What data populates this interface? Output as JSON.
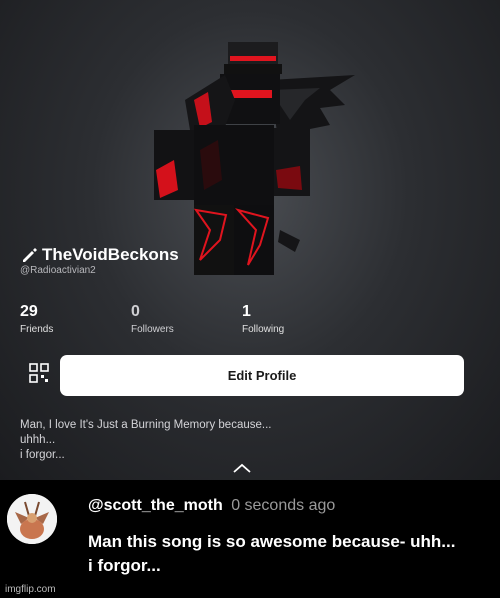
{
  "profile": {
    "display_name": "TheVoidBeckons",
    "username": "@Radioactivian2",
    "stats": [
      {
        "value": "29",
        "label": "Friends"
      },
      {
        "value": "0",
        "label": "Followers"
      },
      {
        "value": "1",
        "label": "Following"
      }
    ],
    "edit_button_label": "Edit Profile",
    "bio_lines": [
      "Man, I love It's Just a Burning Memory because...",
      "uhhh...",
      "i forgor..."
    ],
    "colors": {
      "accent_red": "#e0141e",
      "background": "#2c2e32"
    }
  },
  "comment": {
    "handle": "@scott_the_moth",
    "time": "0 seconds ago",
    "lines": [
      "Man this song is so awesome because- uhh...",
      "i forgor..."
    ]
  },
  "watermark": "imgflip.com"
}
